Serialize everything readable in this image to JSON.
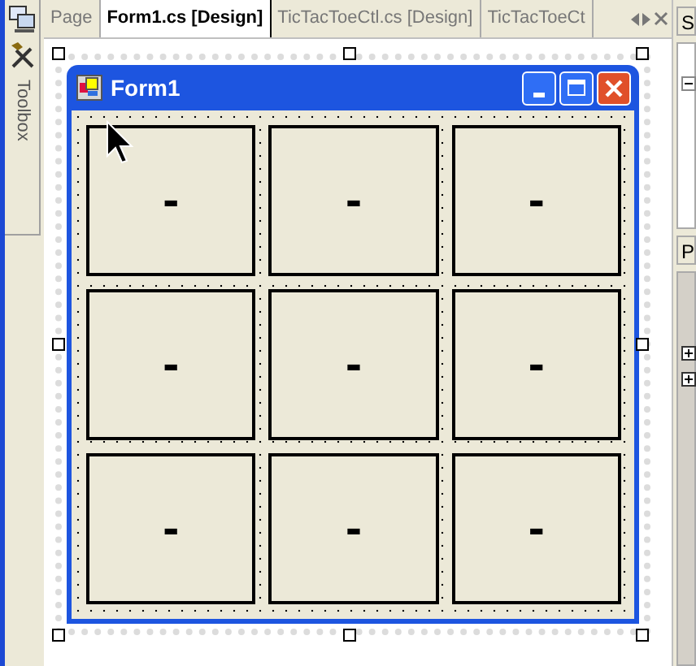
{
  "side_strip": {
    "tab_label": "Toolbox"
  },
  "tabs": [
    {
      "label": "Page",
      "selected": false
    },
    {
      "label": "Form1.cs [Design]",
      "selected": true
    },
    {
      "label": "TicTacToeCtl.cs [Design]",
      "selected": false
    },
    {
      "label": "TicTacToeCt",
      "selected": false
    }
  ],
  "form": {
    "title": "Form1",
    "cells": [
      {
        "label": "-"
      },
      {
        "label": "-"
      },
      {
        "label": "-"
      },
      {
        "label": "-"
      },
      {
        "label": "-"
      },
      {
        "label": "-"
      },
      {
        "label": "-"
      },
      {
        "label": "-"
      },
      {
        "label": "-"
      }
    ]
  },
  "right_panel": {
    "header_1": "S",
    "header_2": "P"
  }
}
